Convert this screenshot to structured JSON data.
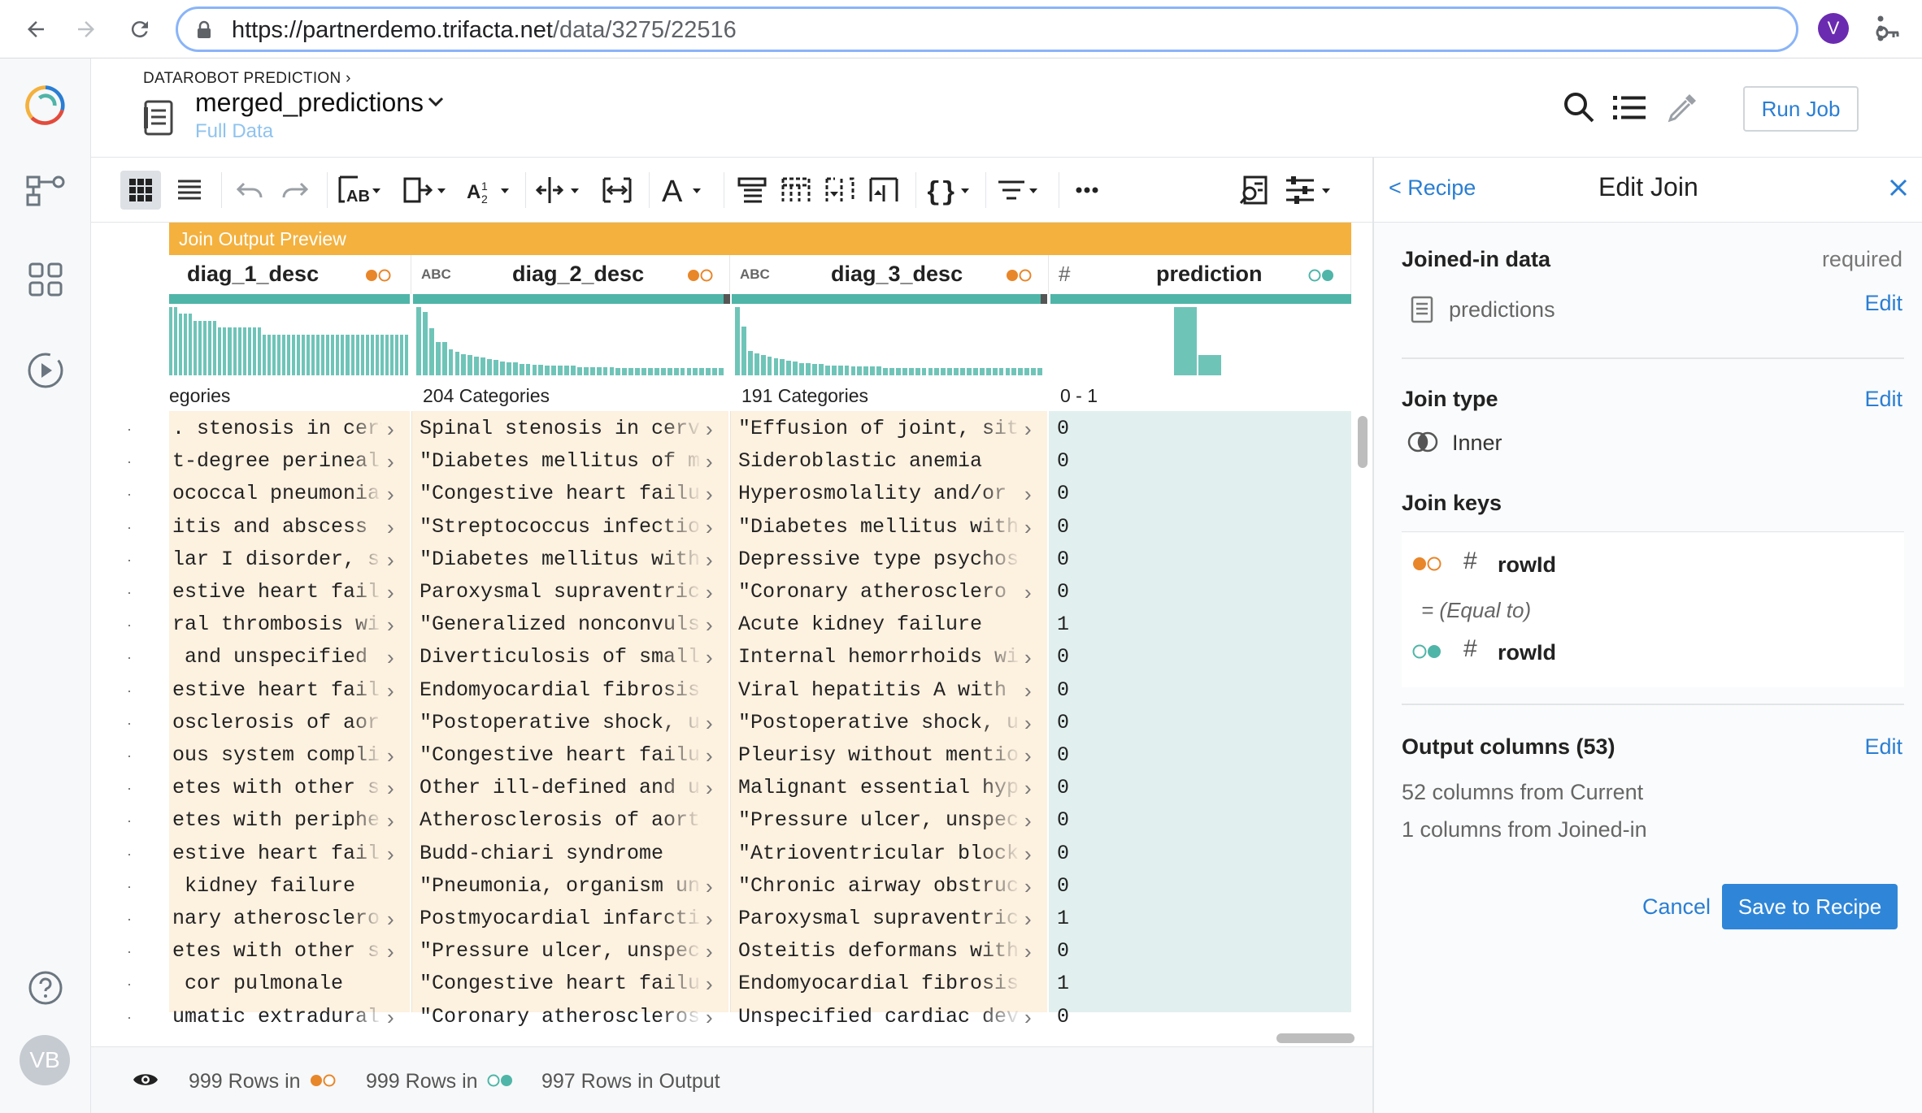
{
  "browser": {
    "url_host": "https://partnerdemo.trifacta.net",
    "url_path": "/data/3275/22516",
    "profile_initial": "V"
  },
  "rail": {
    "user_initials": "VB"
  },
  "header": {
    "breadcrumb": "DATAROBOT PREDICTION",
    "dataset_name": "merged_predictions",
    "sample_label": "Full Data",
    "run_job_label": "Run Job"
  },
  "grid": {
    "banner": "Join Output Preview",
    "columns": [
      {
        "name": "diag_1_desc",
        "type": "",
        "source": "current",
        "categories": "egories"
      },
      {
        "name": "diag_2_desc",
        "type": "ABC",
        "source": "current",
        "categories": "204 Categories"
      },
      {
        "name": "diag_3_desc",
        "type": "ABC",
        "source": "current",
        "categories": "191 Categories"
      },
      {
        "name": "prediction",
        "type": "#",
        "source": "joined",
        "categories": "0 - 1"
      }
    ],
    "histograms": [
      [
        10,
        10,
        9,
        9,
        9,
        8,
        8,
        8,
        8,
        8,
        7,
        7,
        7,
        7,
        7,
        7,
        7,
        7,
        7,
        6,
        6,
        6,
        6,
        6,
        6,
        6,
        6,
        6,
        6,
        6,
        6,
        6,
        6,
        6,
        6,
        6,
        6,
        6,
        6,
        6,
        6,
        6,
        6,
        6,
        6,
        6,
        6,
        6,
        6
      ],
      [
        58,
        54,
        40,
        28,
        28,
        22,
        20,
        18,
        17,
        16,
        15,
        14,
        13,
        12,
        11,
        11,
        10,
        10,
        9,
        9,
        8,
        8,
        8,
        8,
        8,
        7,
        7,
        7,
        7,
        7,
        7,
        6,
        6,
        6,
        6,
        6,
        6,
        6,
        6,
        6,
        6,
        6,
        6,
        6,
        6,
        6,
        6,
        6
      ],
      [
        56,
        40,
        20,
        18,
        17,
        15,
        14,
        13,
        12,
        11,
        10,
        10,
        9,
        9,
        8,
        8,
        8,
        8,
        7,
        7,
        7,
        7,
        7,
        6,
        6,
        6,
        6,
        6,
        6,
        6,
        6,
        6,
        6,
        6,
        6,
        6,
        6,
        6,
        6,
        6,
        6,
        6,
        6,
        6,
        6,
        6,
        6,
        6
      ],
      [
        60,
        18
      ]
    ],
    "rows": [
      {
        "c1": ". stenosis in cerv",
        "c2": "Spinal stenosis in cerv",
        "c3": "\"Effusion of joint, sit",
        "c4": "0"
      },
      {
        "c1": "t-degree perineal",
        "c2": "\"Diabetes mellitus of m",
        "c3": "Sideroblastic anemia",
        "c4": "0"
      },
      {
        "c1": "ococcal pneumonia",
        "c2": "\"Congestive heart failu",
        "c3": "Hyperosmolality and/or",
        "c4": "0"
      },
      {
        "c1": "itis and abscess",
        "c2": "\"Streptococcus infectio",
        "c3": "\"Diabetes mellitus with",
        "c4": "0"
      },
      {
        "c1": "lar I disorder, si",
        "c2": "\"Diabetes mellitus with",
        "c3": "Depressive type psychosis",
        "c4": "0"
      },
      {
        "c1": "estive heart failu",
        "c2": "Paroxysmal supraventric",
        "c3": "\"Coronary atherosclero",
        "c4": "0"
      },
      {
        "c1": "ral thrombosis wit",
        "c2": "\"Generalized nonconvuls",
        "c3": "Acute kidney failure",
        "c4": "1"
      },
      {
        "c1": " and unspecified n",
        "c2": "Diverticulosis of small",
        "c3": "Internal hemorrhoids wi",
        "c4": "0"
      },
      {
        "c1": "estive heart failu",
        "c2": "Endomyocardial fibrosis",
        "c3": "Viral hepatitis A with",
        "c4": "0"
      },
      {
        "c1": "osclerosis of aorta",
        "c2": "\"Postoperative shock, u",
        "c3": "\"Postoperative shock, u",
        "c4": "0"
      },
      {
        "c1": "ous system complic",
        "c2": "\"Congestive heart failu",
        "c3": "Pleurisy without mentio",
        "c4": "0"
      },
      {
        "c1": "etes with other sp",
        "c2": "Other ill-defined and u",
        "c3": "Malignant essential hyp",
        "c4": "0"
      },
      {
        "c1": "etes with peripher",
        "c2": "Atherosclerosis of aorta",
        "c3": "\"Pressure ulcer, unspec",
        "c4": "0"
      },
      {
        "c1": "estive heart failu",
        "c2": "Budd-chiari syndrome",
        "c3": "\"Atrioventricular block",
        "c4": "0"
      },
      {
        "c1": " kidney failure",
        "c2": "\"Pneumonia, organism un",
        "c3": "\"Chronic airway obstruc",
        "c4": "0"
      },
      {
        "c1": "nary atheroscleros",
        "c2": "Postmyocardial infarcti",
        "c3": "Paroxysmal supraventric",
        "c4": "1"
      },
      {
        "c1": "etes with other sp",
        "c2": "\"Pressure ulcer, unspec",
        "c3": "Osteitis deformans with",
        "c4": "0"
      },
      {
        "c1": " cor pulmonale",
        "c2": "\"Congestive heart failu",
        "c3": "Endomyocardial fibrosis",
        "c4": "1"
      },
      {
        "c1": "umatic extradural",
        "c2": "\"Coronary atheroscleros",
        "c3": "Unspecified cardiac dev",
        "c4": "0"
      }
    ],
    "arrows": {
      "c1": [
        true,
        true,
        true,
        true,
        true,
        true,
        true,
        true,
        true,
        false,
        true,
        true,
        true,
        true,
        false,
        true,
        true,
        false,
        true
      ],
      "c2": [
        true,
        true,
        true,
        true,
        true,
        true,
        true,
        true,
        false,
        true,
        true,
        true,
        false,
        false,
        true,
        true,
        true,
        true,
        true
      ],
      "c3": [
        true,
        false,
        true,
        true,
        false,
        true,
        false,
        true,
        true,
        true,
        true,
        true,
        true,
        true,
        true,
        true,
        true,
        false,
        true
      ]
    }
  },
  "status": {
    "rows_current": "999 Rows in",
    "rows_joined": "999 Rows in",
    "rows_output": "997 Rows in Output"
  },
  "panel": {
    "back_label": "< Recipe",
    "title": "Edit Join",
    "joined_in_heading": "Joined-in data",
    "required_label": "required",
    "dataset_name": "predictions",
    "edit_label": "Edit",
    "join_type_heading": "Join type",
    "join_type_value": "Inner",
    "join_keys_heading": "Join keys",
    "key_current": "rowId",
    "key_operator": "= (Equal to)",
    "key_joined": "rowId",
    "output_heading": "Output columns (53)",
    "output_current": "52 columns from Current",
    "output_joined": "1 columns from Joined-in",
    "cancel_label": "Cancel",
    "save_label": "Save to Recipe"
  },
  "colors": {
    "current_source": "#e8862a",
    "joined_source": "#4fb5a8",
    "accent": "#2a7ed3",
    "banner": "#f4b13e",
    "cell_current_bg": "#fdf1e0",
    "cell_joined_bg": "#e1f0ee"
  }
}
